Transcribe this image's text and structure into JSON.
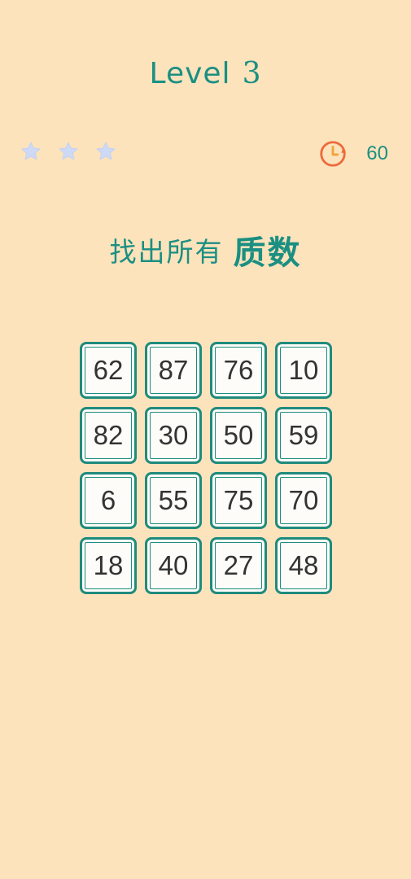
{
  "header": {
    "level_label": "Level",
    "level_number": "3"
  },
  "stars": {
    "total": 3,
    "earned": 0,
    "color": "#cdd9f5"
  },
  "timer": {
    "icon": "clock-icon",
    "value": "60",
    "icon_color": "#ee6a3c"
  },
  "instruction": {
    "prefix": "找出所有",
    "target": "质数"
  },
  "grid": {
    "rows": [
      [
        "62",
        "87",
        "76",
        "10"
      ],
      [
        "82",
        "30",
        "50",
        "59"
      ],
      [
        "6",
        "55",
        "75",
        "70"
      ],
      [
        "18",
        "40",
        "27",
        "48"
      ]
    ]
  },
  "colors": {
    "background": "#fce3bc",
    "accent": "#1b8f82",
    "tile_border": "#1f8b7d",
    "tile_fill": "#fdfcf8",
    "tile_text": "#333333"
  }
}
